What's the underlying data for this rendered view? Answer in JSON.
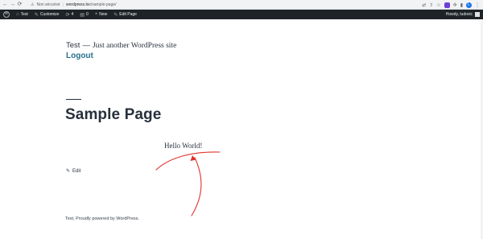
{
  "browser": {
    "back": "←",
    "forward": "→",
    "reload": "⟳",
    "security_label": "Non sécurisé",
    "separator": "|",
    "url_host": "wordpress.loc",
    "url_path": "/sample-page/",
    "profile_letter": "L"
  },
  "admin_bar": {
    "logo": "W",
    "site_name": "Test",
    "customize": "Customize",
    "updates_count": "4",
    "comments_count": "0",
    "new": "New",
    "edit_page": "Edit Page",
    "howdy": "Howdy, ludovic"
  },
  "site": {
    "title": "Test",
    "dash": "—",
    "tagline": "Just another WordPress site",
    "menu": [
      {
        "label": "Logout"
      }
    ]
  },
  "page": {
    "title": "Sample Page",
    "content": "Hello World!",
    "edit_label": "Edit"
  },
  "footer": {
    "text": "Test, Proudly powered by WordPress."
  },
  "colors": {
    "admin_bar_bg": "#1d2327",
    "link": "#28718d",
    "text": "#28303d",
    "annotation": "#e0312b"
  }
}
